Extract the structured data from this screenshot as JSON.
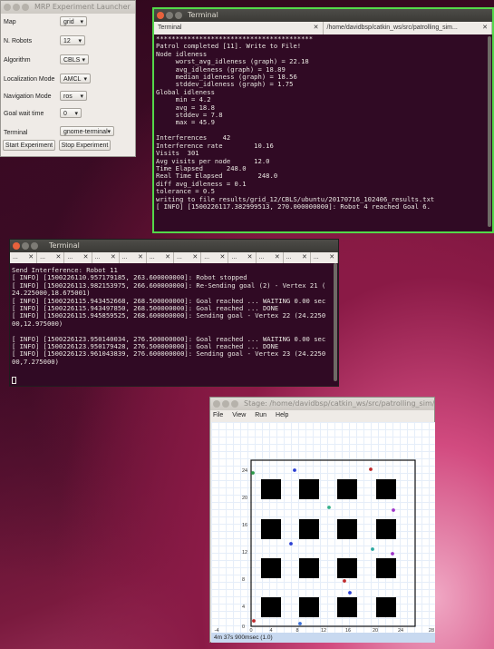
{
  "launcher": {
    "title": "MRP Experiment Launcher",
    "rows": [
      {
        "label": "Map",
        "value": "grid"
      },
      {
        "label": "N. Robots",
        "value": "12"
      },
      {
        "label": "Algorithm",
        "value": "CBLS"
      },
      {
        "label": "Localization Mode",
        "value": "AMCL"
      },
      {
        "label": "Navigation Mode",
        "value": "ros"
      },
      {
        "label": "Goal wait time",
        "value": "0"
      },
      {
        "label": "Terminal",
        "value": "gnome-terminal"
      }
    ],
    "start_label": "Start Experiment",
    "stop_label": "Stop Experiment"
  },
  "term1": {
    "title": "Terminal",
    "tabs": [
      {
        "label": "Terminal"
      },
      {
        "label": "/home/davidbsp/catkin_ws/src/patrolling_sim..."
      }
    ],
    "lines": [
      "****************************************",
      "Patrol completed [11]. Write to File!",
      "Node idleness",
      "     worst_avg_idleness (graph) = 22.18",
      "     avg_idleness (graph) = 18.89",
      "     median_idleness (graph) = 18.56",
      "     stddev_idleness (graph) = 1.75",
      "Global idleness",
      "     min = 4.2",
      "     avg = 18.8",
      "     stddev = 7.8",
      "     max = 45.9",
      "",
      "Interferences    42",
      "Interference rate        10.16",
      "Visits  301",
      "Avg visits per node      12.0",
      "Time Elapsed      248.0",
      "Real Time Elapsed         248.0",
      "diff avg_idleness = 0.1",
      "tolerance = 0.5",
      "writing to file results/grid_12/CBLS/ubuntu/20170716_102406_results.txt",
      "[ INFO] [1500226117.382999513, 270.000000000]: Robot 4 reached Goal 6."
    ]
  },
  "term2": {
    "title": "Terminal",
    "tabs": [
      "...",
      "...",
      "...",
      "...",
      "...",
      "...",
      "...",
      "...",
      "...",
      "...",
      "...",
      "..."
    ],
    "lines": [
      "Send Interference: Robot 11",
      "[ INFO] [1500226110.957179185, 263.600000000]: Robot stopped",
      "[ INFO] [1500226113.982153975, 266.600000000]: Re-Sending goal (2) - Vertex 21 (",
      "24.225000,18.675001)",
      "[ INFO] [1500226115.943452668, 268.500000000]: Goal reached ... WAITING 0.00 sec",
      "[ INFO] [1500226115.943497850, 268.500000000]: Goal reached ... DONE",
      "[ INFO] [1500226115.945859525, 268.600000000]: Sending goal - Vertex 22 (24.2250",
      "00,12.975000)",
      "",
      "[ INFO] [1500226123.950140034, 276.500000000]: Goal reached ... WAITING 0.00 sec",
      "[ INFO] [1500226123.950179428, 276.500000000]: Goal reached ... DONE",
      "[ INFO] [1500226123.961043839, 276.600000000]: Sending goal - Vertex 23 (24.2250",
      "00,7.275000)"
    ]
  },
  "stage": {
    "title": "Stage: /home/davidbsp/catkin_ws/src/patrolling_sim/map...",
    "menu": [
      "File",
      "View",
      "Run",
      "Help"
    ],
    "y_ticks": [
      "24",
      "20",
      "16",
      "12",
      "8",
      "4",
      "0"
    ],
    "x_ticks": [
      "-4",
      "0",
      "4",
      "8",
      "12",
      "16",
      "20",
      "24",
      "28"
    ],
    "status": "4m 37s 900msec (1.0)",
    "robots": [
      {
        "color": "#2e9b4a"
      },
      {
        "color": "#2b3fd4"
      },
      {
        "color": "#c0282a"
      },
      {
        "color": "#35b08a"
      },
      {
        "color": "#a035c9"
      },
      {
        "color": "#2b3fd4"
      },
      {
        "color": "#2aa7a0"
      },
      {
        "color": "#a035c9"
      },
      {
        "color": "#c0282a"
      },
      {
        "color": "#2b3fd4"
      },
      {
        "color": "#c0282a"
      },
      {
        "color": "#3a6fd8"
      }
    ]
  }
}
